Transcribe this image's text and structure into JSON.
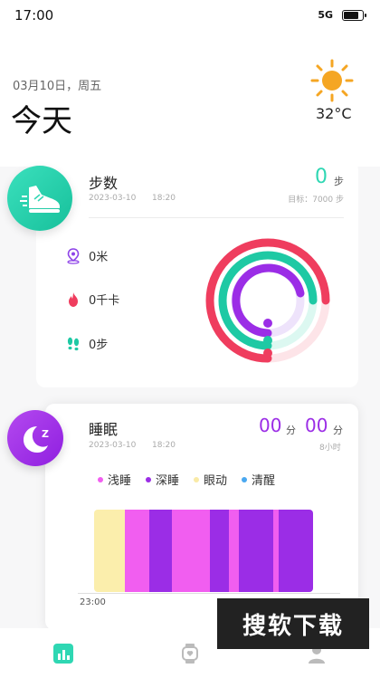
{
  "status": {
    "time": "17:00",
    "network": "5G"
  },
  "header": {
    "date": "03月10日，周五",
    "title": "今天",
    "temperature": "32°C",
    "weather_icon": "sun-icon"
  },
  "steps": {
    "title": "步数",
    "date": "2023-03-10",
    "time": "18:20",
    "value": "0",
    "unit": "步",
    "goal": "目标：7000 步",
    "metrics": [
      {
        "icon": "location-icon",
        "label": "0米",
        "color": "#8e44e8"
      },
      {
        "icon": "flame-icon",
        "label": "0千卡",
        "color": "#ef3d5e"
      },
      {
        "icon": "footprints-icon",
        "label": "0步",
        "color": "#1ec9a4"
      }
    ],
    "colors": {
      "steps": "#1ec9a4",
      "calories": "#ef3d5e",
      "distance": "#9b2de6"
    }
  },
  "sleep": {
    "title": "睡眠",
    "date": "2023-03-10",
    "time": "18:20",
    "hours": "00",
    "hours_unit": "分",
    "minutes": "00",
    "minutes_unit": "分",
    "goal": "8小时",
    "legend": [
      {
        "label": "浅睡",
        "color": "#f15ef0"
      },
      {
        "label": "深睡",
        "color": "#9b2de6"
      },
      {
        "label": "眼动",
        "color": "#f9eaa6"
      },
      {
        "label": "清醒",
        "color": "#4aa8f0"
      }
    ],
    "chart_start": "23:00"
  },
  "watermark": "搜软下载"
}
